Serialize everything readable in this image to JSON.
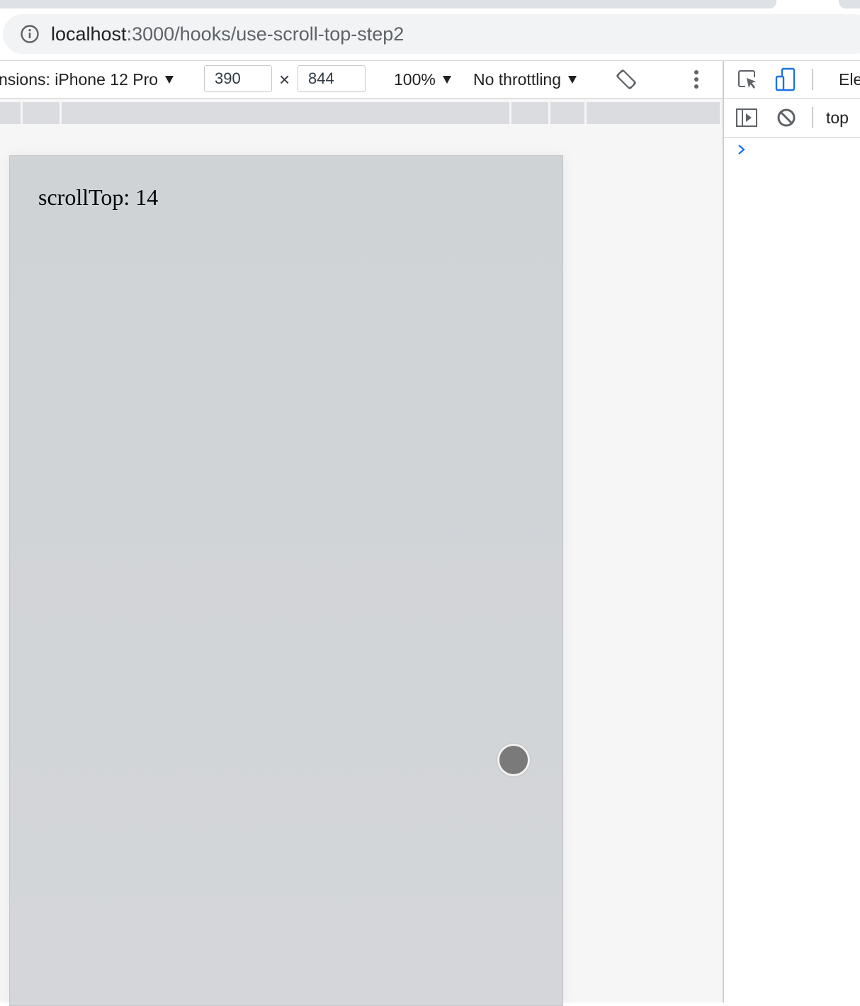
{
  "browser": {
    "url_host": "localhost",
    "url_path": ":3000/hooks/use-scroll-top-step2"
  },
  "device_toolbar": {
    "dimensions_label": "nsions: iPhone 12 Pro",
    "width_value": "390",
    "times_symbol": "×",
    "height_value": "844",
    "zoom": "100%",
    "throttling": "No throttling"
  },
  "page": {
    "scroll_top_text": "scrollTop: 14"
  },
  "devtools": {
    "elements_tab": "Ele",
    "context": "top"
  },
  "icons": {
    "info": "info-icon",
    "rotate": "rotate-icon",
    "more": "kebab-menu-icon",
    "inspect": "inspect-element-icon",
    "device": "device-toggle-icon",
    "sidebar": "console-sidebar-icon",
    "clear": "clear-console-icon",
    "prompt": "console-prompt-icon"
  },
  "colors": {
    "device_bg": "#d1d5d8",
    "accent_blue": "#1a73e8",
    "omnibox_bg": "#f1f3f4"
  }
}
